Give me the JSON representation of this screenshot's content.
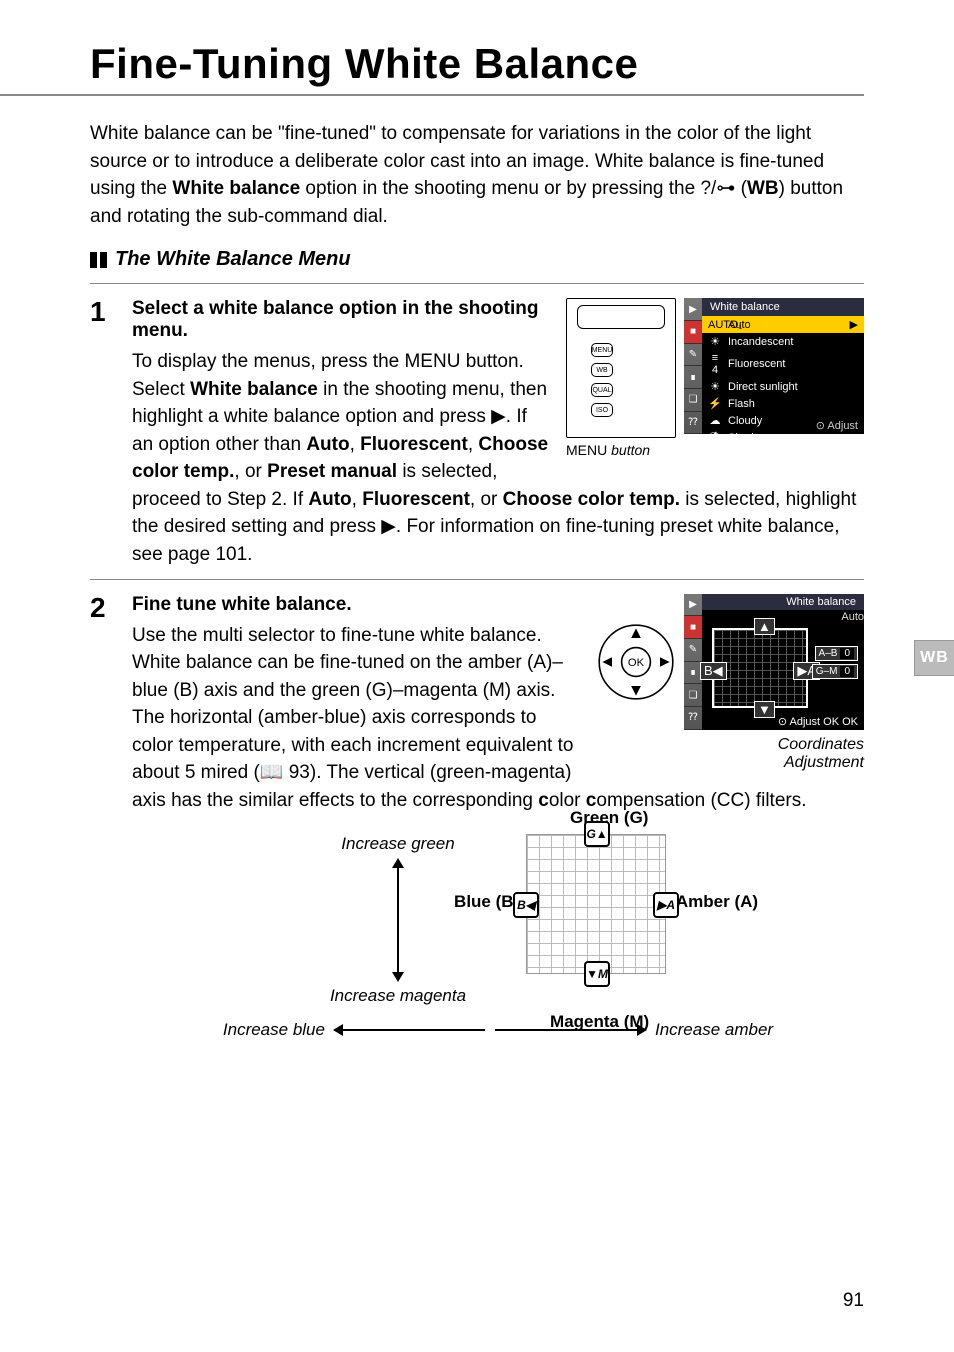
{
  "title": "Fine-Tuning White Balance",
  "intro_parts": {
    "p1": "White balance can be \"fine-tuned\" to compensate for variations in the color of the light source or to introduce a deliberate color cast into an image.  White balance is fine-tuned using the ",
    "b1": "White balance",
    "p2": " option in the shooting menu or by pressing the ",
    "qual_glyph": "?/⊶",
    "p3": " (",
    "b2": "WB",
    "p4": ") button and rotating the sub-command dial."
  },
  "subhead": "The White Balance Menu",
  "step1": {
    "num": "1",
    "head": "Select a white balance option in the shooting menu.",
    "t1": "To display the menus, press the ",
    "menu_glyph": "MENU",
    "t2": " button. Select ",
    "b1": "White balance",
    "t3": " in the shooting menu, then highlight a white balance option and press ",
    "arrow": "▶",
    "t4": ".  If an option other than ",
    "b2": "Auto",
    "comma": ", ",
    "b3": "Fluorescent",
    "b4": "Choose color temp.",
    "or": ", or ",
    "b5": "Preset manual",
    "t5": " is selected, proceed to Step 2.  If ",
    "b6": "Auto",
    "b7": "Fluorescent",
    "b8": "Choose color temp.",
    "t6": " is selected, highlight the desired setting and press ",
    "t7": ".  For information on fine-tuning preset white balance, see page 101."
  },
  "menu_caption": "MENU button",
  "cam_buttons": [
    "MENU",
    "WB",
    "QUAL",
    "ISO"
  ],
  "menu1": {
    "header": "White balance",
    "side": [
      "▶",
      "■",
      "✎",
      "∎",
      "❏",
      "⁇"
    ],
    "rows": [
      {
        "icon": "AUTO₁",
        "label": "Auto",
        "sel": true
      },
      {
        "icon": "☀︎",
        "label": "Incandescent"
      },
      {
        "icon": "≡ 4",
        "label": "Fluorescent"
      },
      {
        "icon": "☀",
        "label": "Direct sunlight"
      },
      {
        "icon": "⚡",
        "label": "Flash"
      },
      {
        "icon": "☁",
        "label": "Cloudy"
      },
      {
        "icon": "⛱",
        "label": "Shade"
      }
    ],
    "footer": "⊙ Adjust"
  },
  "step2": {
    "num": "2",
    "head": "Fine tune white balance.",
    "t1": "Use the multi selector to fine-tune white balance.  White balance can be fine-tuned on the amber (A)–blue (B) axis and the green (G)–magenta (M) axis.  The horizontal (amber-blue) axis corresponds to color temperature, with each increment equivalent to about 5 mired (",
    "pageref": "📖 93",
    "t2": ").  The vertical (green-magenta) axis has the similar effects to the corresponding ",
    "b1": "c",
    "t3": "olor ",
    "b2": "c",
    "t4": "ompensation (CC) filters."
  },
  "grid_screen": {
    "header": "White balance",
    "sub": "Auto",
    "ab": "A–B",
    "gm": "G–M",
    "ab_val": "0",
    "gm_val": "0",
    "footer": "⊙ Adjust  OK OK"
  },
  "coord_label": "Coordinates",
  "adj_label": "Adjustment",
  "wb_tab": "WB",
  "diagram": {
    "green_top": "Increase green",
    "green_bot": "Increase magenta",
    "g": "Green (G)",
    "b": "Blue (B)",
    "a": "Amber (A)",
    "m": "Magenta (M)",
    "blue": "Increase blue",
    "amber": "Increase amber",
    "btn_g": "G▲",
    "btn_m": "▼M",
    "btn_b": "B◀",
    "btn_a": "▶A"
  },
  "page_number": "91"
}
